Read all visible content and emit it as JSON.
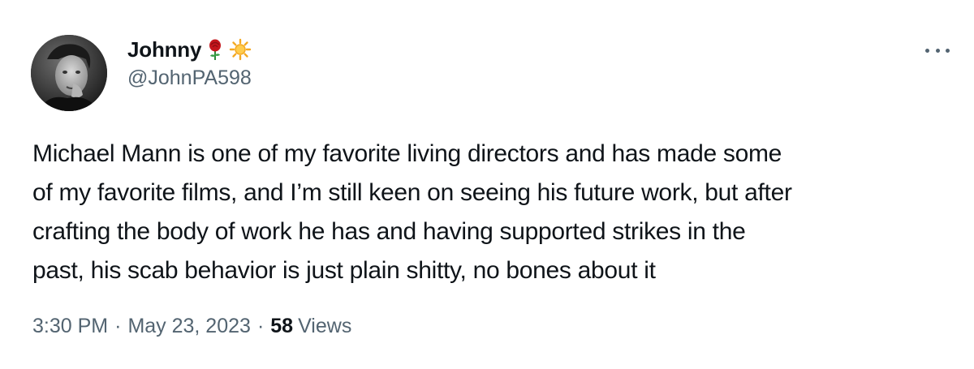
{
  "author": {
    "display_name": "Johnny",
    "handle": "@JohnPA598",
    "name_emojis": [
      "rose-icon",
      "sun-icon"
    ],
    "avatar": "avatar-photo"
  },
  "tweet": {
    "text": "Michael Mann is one of my favorite living directors and has made some\nof my favorite films, and I’m still keen on seeing his future work, but after\ncrafting the body of work he has and having supported strikes in the\npast, his scab behavior is just plain shitty, no bones about it"
  },
  "meta": {
    "time": "3:30 PM",
    "separator": "·",
    "date": "May 23, 2023",
    "views_count": "58",
    "views_label": "Views"
  },
  "menu": {
    "icon": "more-options-icon"
  },
  "colors": {
    "text_primary": "#0f1419",
    "text_secondary": "#536471",
    "background": "#ffffff"
  }
}
